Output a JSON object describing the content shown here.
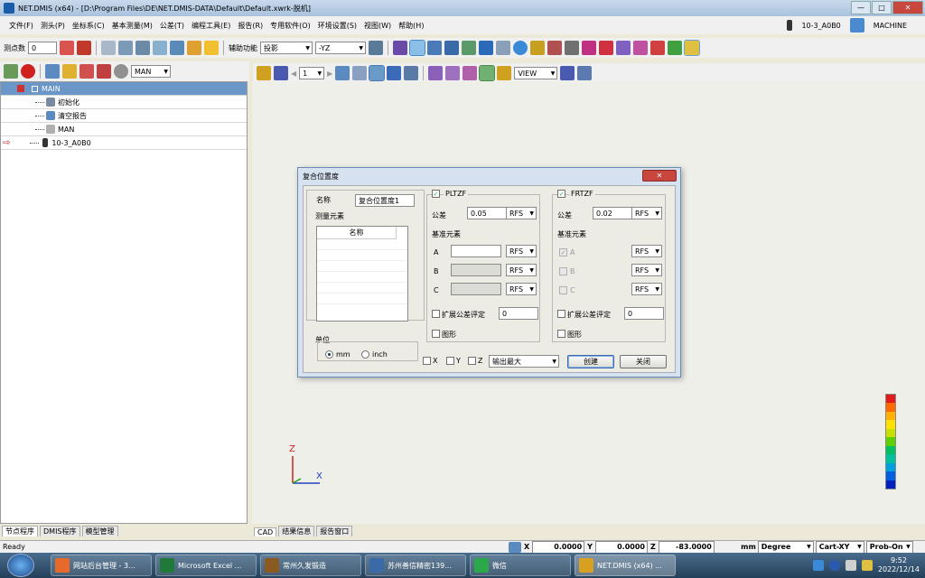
{
  "window": {
    "title": "NET.DMIS (x64) - [D:\\Program Files\\DE\\NET.DMIS-DATA\\Default\\Default.xwrk-脱机]",
    "minimize": "—",
    "maximize": "□",
    "close": "✕"
  },
  "menu": {
    "items": [
      "文件(F)",
      "测头(P)",
      "坐标系(C)",
      "基本测量(M)",
      "公差(T)",
      "编程工具(E)",
      "报告(R)",
      "专用软件(O)",
      "环境设置(S)",
      "视图(W)",
      "帮助(H)"
    ],
    "probe_name": "10-3_A0B0",
    "mode": "MACHINE"
  },
  "toolbar1": {
    "points_label": "测点数",
    "points_value": "0",
    "aux_label": "辅助功能",
    "projection_value": "投影",
    "axis_value": "-YZ"
  },
  "toolbar2": {
    "mode_value": "MAN"
  },
  "tree": {
    "rows": [
      {
        "label": "MAIN",
        "selected": true
      },
      {
        "label": "初始化"
      },
      {
        "label": "清空报告"
      },
      {
        "label": "MAN",
        "sub": "Mode"
      },
      {
        "label": "10-3_A0B0",
        "current": true
      }
    ],
    "tabs": [
      "节点程序",
      "DMIS程序",
      "模型管理"
    ]
  },
  "cad_toolbar": {
    "page_value": "1",
    "view_value": "VIEW"
  },
  "cad_tabs": [
    "CAD",
    "结果信息",
    "报告窗口"
  ],
  "axes": {
    "z": "Z",
    "x": "X"
  },
  "legend_colors": [
    "#e31a1c",
    "#ff6a00",
    "#ffb000",
    "#ffe000",
    "#c8e000",
    "#5ed000",
    "#00c060",
    "#00c0a0",
    "#00a0e0",
    "#0060e0",
    "#0020c0"
  ],
  "dialog": {
    "title": "复合位置度",
    "name_label": "名称",
    "name_value": "复合位置度1",
    "measure_label": "测量元素",
    "list_header": "名称",
    "unit_label": "单位",
    "unit_mm": "mm",
    "unit_inch": "inch",
    "pltzf": {
      "label": "PLTZF",
      "checked": true,
      "tol_label": "公差",
      "tol_value": "0.05",
      "tol_mod": "RFS",
      "datum_label": "基准元素",
      "datums": [
        {
          "label": "A",
          "value": "",
          "mod": "RFS",
          "enabled": true
        },
        {
          "label": "B",
          "value": "",
          "mod": "RFS",
          "enabled": false
        },
        {
          "label": "C",
          "value": "",
          "mod": "RFS",
          "enabled": false
        }
      ],
      "ext_label": "扩展公差评定",
      "ext_value": "0",
      "graph_label": "图形"
    },
    "frtzf": {
      "label": "FRTZF",
      "checked": true,
      "tol_label": "公差",
      "tol_value": "0.02",
      "tol_mod": "RFS",
      "datum_label": "基准元素",
      "datums": [
        {
          "label": "A",
          "mod": "RFS",
          "checked": true
        },
        {
          "label": "B",
          "mod": "RFS",
          "checked": false
        },
        {
          "label": "C",
          "mod": "RFS",
          "checked": false
        }
      ],
      "ext_label": "扩展公差评定",
      "ext_value": "0",
      "graph_label": "图形"
    },
    "x_label": "X",
    "y_label": "Y",
    "z_label": "Z",
    "output_value": "输出最大",
    "create_label": "创建",
    "close_label": "关闭"
  },
  "status": {
    "ready": "Ready",
    "x_label": "X",
    "x_value": "0.0000",
    "y_label": "Y",
    "y_value": "0.0000",
    "z_label": "Z",
    "z_value": "-83.0000",
    "unit": "mm",
    "angle": "Degree",
    "coord": "Cart-XY",
    "probe": "Prob-On"
  },
  "taskbar": {
    "tasks": [
      {
        "label": "网站后台管理 - 3...",
        "color": "#e86a2a"
      },
      {
        "label": "Microsoft Excel ...",
        "color": "#1f7a3a"
      },
      {
        "label": "常州久发锻造",
        "color": "#8a5a20"
      },
      {
        "label": "苏州善信精密139...",
        "color": "#3a6aa8"
      },
      {
        "label": "微信",
        "color": "#2aa84a"
      },
      {
        "label": "NET.DMIS (x64) ...",
        "color": "#d8a020"
      }
    ],
    "time": "9:52",
    "date": "2022/12/14"
  }
}
